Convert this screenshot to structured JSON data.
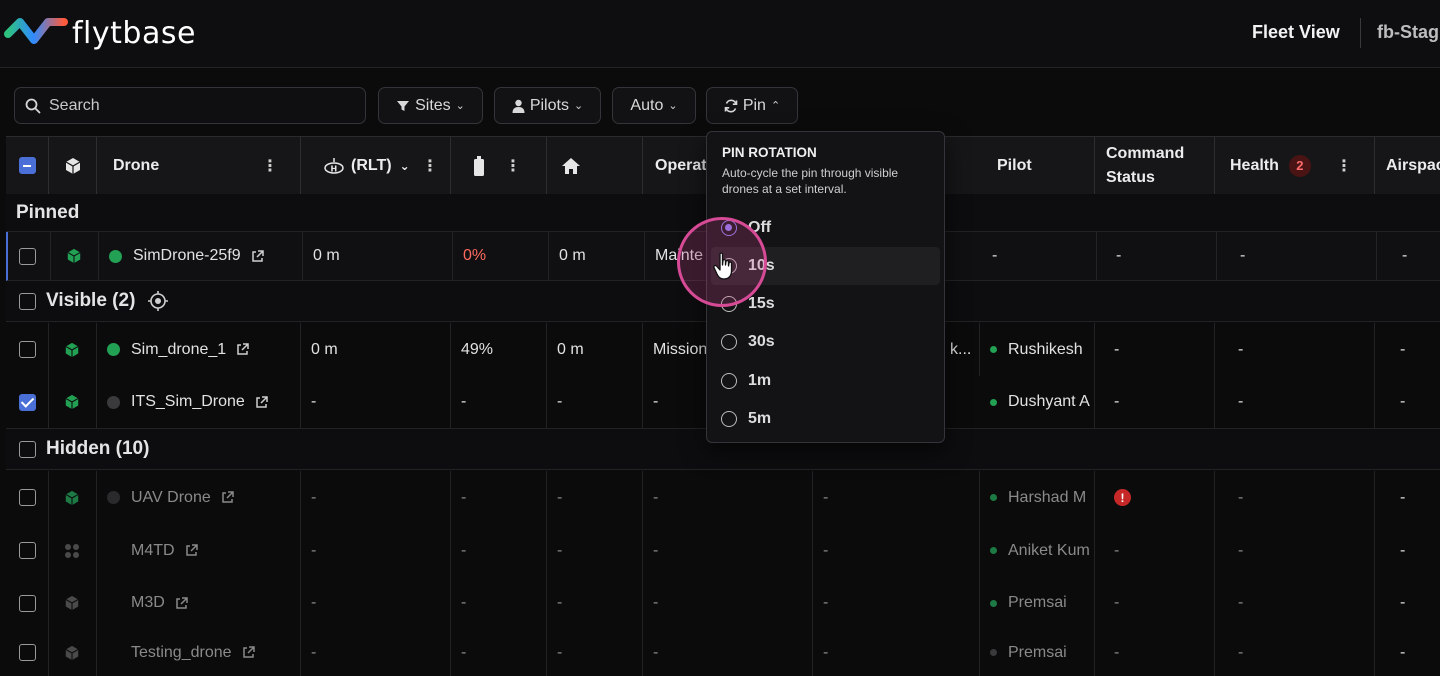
{
  "header": {
    "logo_text": "flytbase",
    "title": "Fleet View",
    "org": "fb-Stag"
  },
  "toolbar": {
    "search_placeholder": "Search",
    "sites_label": "Sites",
    "pilots_label": "Pilots",
    "auto_label": "Auto",
    "pin_label": "Pin"
  },
  "columns": {
    "drone": "Drone",
    "rlt": "(RLT)",
    "operation": "Operat",
    "pilot": "Pilot",
    "command_status": "Command Status",
    "health": "Health",
    "health_count": "2",
    "airspace": "Airspac"
  },
  "groups": {
    "pinned": "Pinned",
    "visible": "Visible (2)",
    "hidden": "Hidden (10)"
  },
  "rows": {
    "pinned": [
      {
        "name": "SimDrone-25f9",
        "rlt": "0 m",
        "battery": "0%",
        "home": "0 m",
        "operation": "Mainte",
        "pilot": "-",
        "command": "-",
        "health": "-",
        "airspace": "-"
      }
    ],
    "visible": [
      {
        "name": "Sim_drone_1",
        "rlt": "0 m",
        "battery": "49%",
        "home": "0 m",
        "operation": "Mission",
        "extra": "k...",
        "pilot": "Rushikesh",
        "command": "-",
        "health": "-",
        "airspace": "-"
      },
      {
        "name": "ITS_Sim_Drone",
        "rlt": "-",
        "battery": "-",
        "home": "-",
        "operation": "-",
        "pilot": "Dushyant A",
        "command": "-",
        "health": "-",
        "airspace": "-"
      }
    ],
    "hidden": [
      {
        "name": "UAV Drone",
        "rlt": "-",
        "battery": "-",
        "home": "-",
        "operation": "-",
        "extra": "-",
        "pilot": "Harshad M",
        "command": "!",
        "health": "-",
        "airspace": "-"
      },
      {
        "name": "M4TD",
        "rlt": "-",
        "battery": "-",
        "home": "-",
        "operation": "-",
        "extra": "-",
        "pilot": "Aniket Kum",
        "command": "-",
        "health": "-",
        "airspace": "-"
      },
      {
        "name": "M3D",
        "rlt": "-",
        "battery": "-",
        "home": "-",
        "operation": "-",
        "extra": "-",
        "pilot": "Premsai",
        "command": "-",
        "health": "-",
        "airspace": "-"
      },
      {
        "name": "Testing_drone",
        "rlt": "-",
        "battery": "-",
        "home": "-",
        "operation": "-",
        "extra": "-",
        "pilot": "Premsai",
        "command": "-",
        "health": "-",
        "airspace": "-"
      }
    ]
  },
  "pin_popup": {
    "title": "PIN ROTATION",
    "description": "Auto-cycle the pin through visible drones at a set interval.",
    "options": [
      "Off",
      "10s",
      "15s",
      "30s",
      "1m",
      "5m"
    ],
    "selected": "Off"
  },
  "colors": {
    "accent": "#4a6fd6",
    "online": "#22a053",
    "error": "#c62828",
    "radio_selected": "#8c7cf0",
    "cursor_highlight": "#d64a96"
  }
}
